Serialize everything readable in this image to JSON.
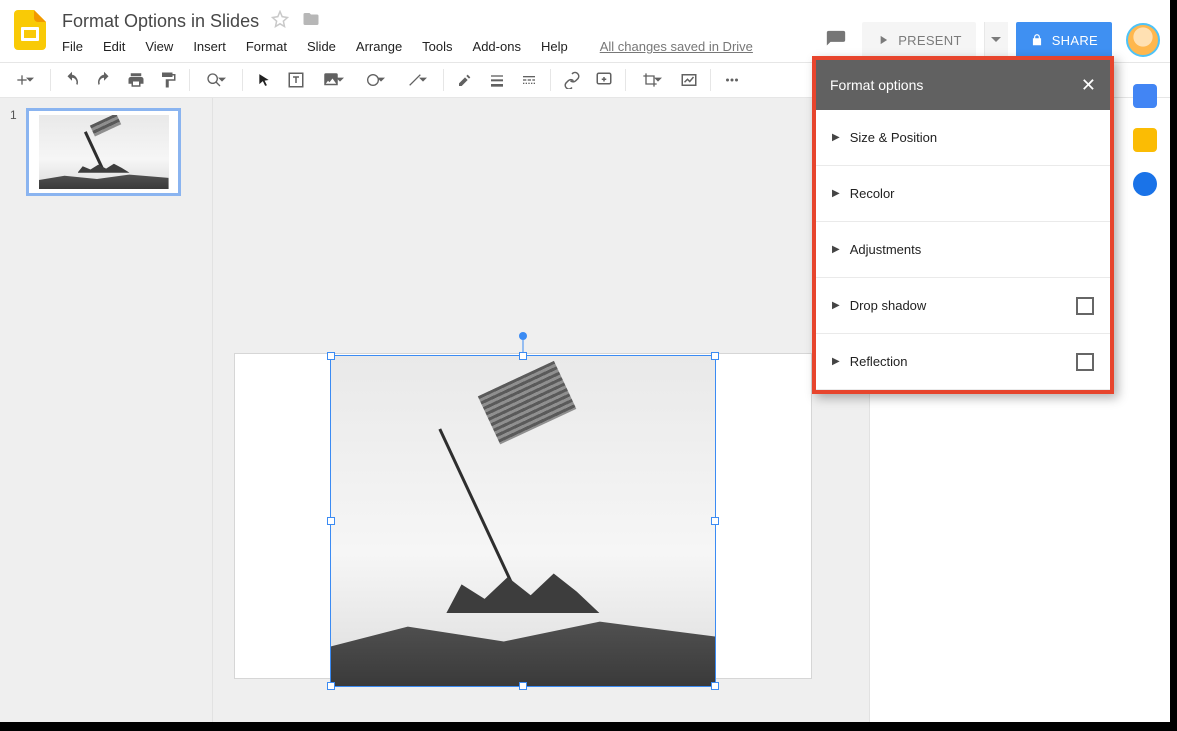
{
  "document": {
    "title": "Format Options in Slides",
    "saved_status": "All changes saved in Drive"
  },
  "menu": {
    "file": "File",
    "edit": "Edit",
    "view": "View",
    "insert": "Insert",
    "format": "Format",
    "slide": "Slide",
    "arrange": "Arrange",
    "tools": "Tools",
    "addons": "Add-ons",
    "help": "Help"
  },
  "actions": {
    "present": "PRESENT",
    "share": "SHARE"
  },
  "slide_number": "1",
  "format_options": {
    "title": "Format options",
    "items": [
      {
        "label": "Size & Position",
        "checkbox": false
      },
      {
        "label": "Recolor",
        "checkbox": false
      },
      {
        "label": "Adjustments",
        "checkbox": false
      },
      {
        "label": "Drop shadow",
        "checkbox": true
      },
      {
        "label": "Reflection",
        "checkbox": true
      }
    ]
  }
}
